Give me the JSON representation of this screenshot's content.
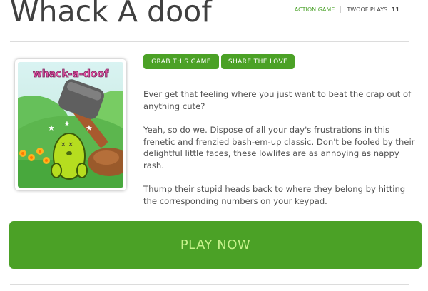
{
  "game": {
    "title": "Whack A doof",
    "category": "ACTION GAME",
    "plays_label": "TWOOF PLAYS:",
    "plays_count": "11",
    "thumbnail_logo": "whack-a-doof"
  },
  "actions": {
    "grab_label": "GRAB THIS GAME",
    "share_label": "SHARE THE LOVE",
    "play_label": "PLAY NOW"
  },
  "description": {
    "p1": "Ever get that feeling where you just want to beat the crap out of anything cute?",
    "p2": "Yeah, so do we. Dispose of all your day's frustrations in this frenetic and frenzied bash-em-up classic. Don't be fooled by their delightful little faces, these lowlifes are as annoying as nappy rash.",
    "p3": "Thump their stupid heads back to where they belong by hitting the corresponding numbers on your keypad."
  },
  "colors": {
    "accent": "#4ba126",
    "play_text": "#c6f28b",
    "title": "#404040",
    "category": "#4aa229"
  }
}
